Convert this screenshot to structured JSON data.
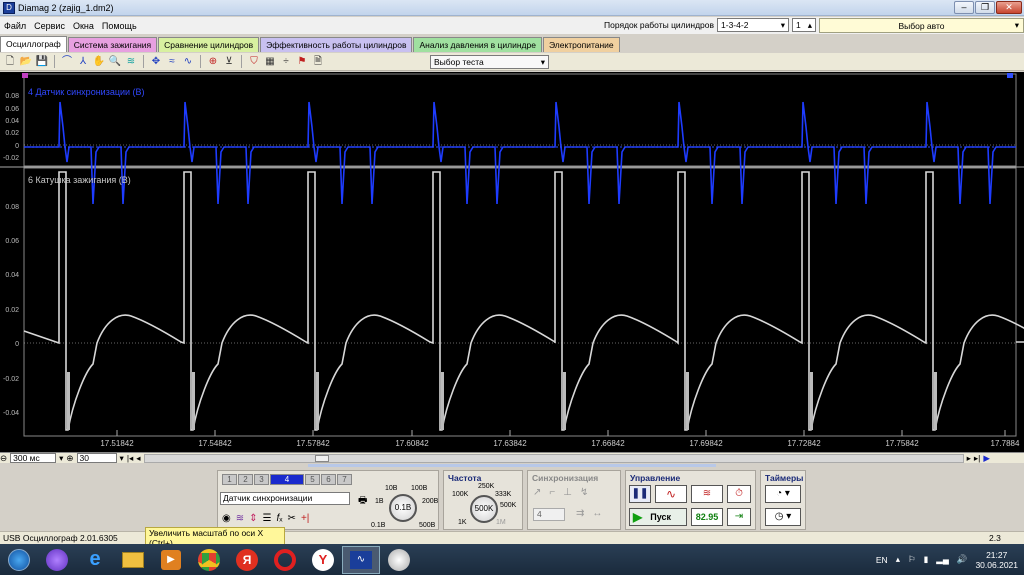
{
  "window": {
    "title": "Diamag 2 (zajig_1.dm2)"
  },
  "menu": [
    "Файл",
    "Сервис",
    "Окна",
    "Помощь"
  ],
  "cylinder_order": {
    "label": "Порядок работы цилиндров",
    "value": "1-3-4-2",
    "cylinder": "1"
  },
  "auto_select": "Выбор авто",
  "tabs": [
    {
      "label": "Осциллограф",
      "color": "#ffffff"
    },
    {
      "label": "Система зажигания",
      "color": "#e7a0e0"
    },
    {
      "label": "Сравнение цилиндров",
      "color": "#d8f0a0"
    },
    {
      "label": "Эффективность работы цилиндров",
      "color": "#c8c0f0"
    },
    {
      "label": "Анализ давления в цилиндре",
      "color": "#a0e0a0"
    },
    {
      "label": "Электропитание",
      "color": "#f0d0a0"
    }
  ],
  "test_select": "Выбор теста",
  "scope": {
    "top_channel": {
      "name": "4 Датчик синхронизации (В)",
      "yticks": [
        "0.08",
        "0.06",
        "0.04",
        "0.02",
        "0",
        "-0.02"
      ],
      "color": "#1e3cff"
    },
    "bottom_channel": {
      "name": "6 Катушка зажигания (В)",
      "yticks": [
        "0.08",
        "0.06",
        "0.04",
        "0.02",
        "0",
        "-0.02",
        "-0.04"
      ],
      "color": "#d8d8d8"
    },
    "xticks": [
      "17.51842",
      "17.54842",
      "17.57842",
      "17.60842",
      "17.63842",
      "17.66842",
      "17.69842",
      "17.72842",
      "17.75842",
      "17.7884"
    ],
    "marker_left": "1",
    "marker_right": "2"
  },
  "timebase": {
    "time": "300 мс",
    "count": "30"
  },
  "control": {
    "channels": [
      "1",
      "2",
      "3",
      "4",
      "5",
      "6",
      "7"
    ],
    "active_channel": "4",
    "source": "Датчик синхронизации",
    "range_labels": [
      "10В",
      "100В",
      "1В",
      "200В",
      "0.1В",
      "500В"
    ],
    "range_value": "0.1В",
    "freq_title": "Частота",
    "freq_labels": [
      "250K",
      "100K",
      "333K",
      "500K",
      "1K",
      "1M"
    ],
    "freq_value": "500K",
    "sync_title": "Синхронизация",
    "sync_value": "4",
    "manage_title": "Управление",
    "start_label": "Пуск",
    "rpm": "82.95",
    "timers_title": "Таймеры"
  },
  "status": {
    "left": "USB Осциллограф  2.01.6305",
    "hint": "Увеличить масштаб по оси X (Ctrl+)",
    "right": "2.3"
  },
  "taskbar": {
    "lang": "EN",
    "time": "21:27",
    "date": "30.06.2021"
  }
}
